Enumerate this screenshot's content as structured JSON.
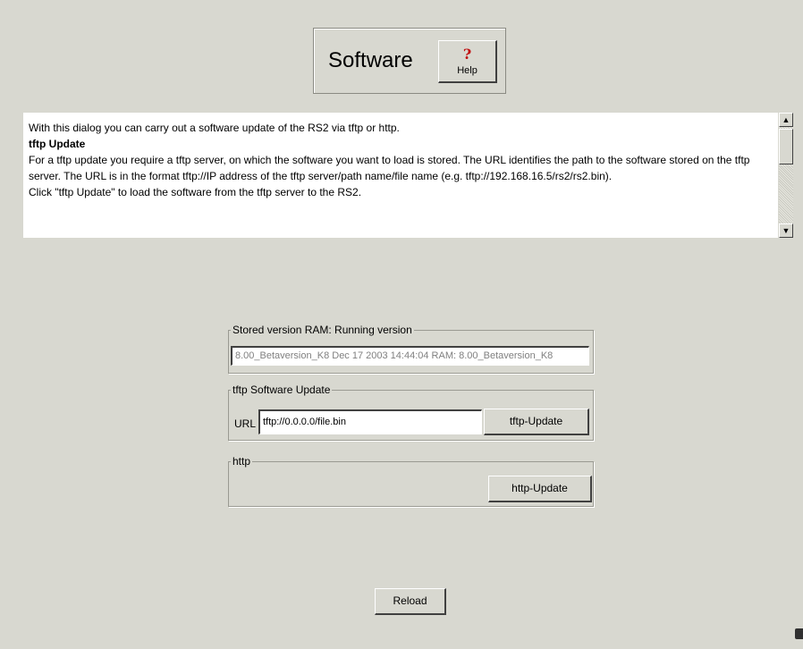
{
  "header": {
    "title": "Software",
    "help_icon": "help-question-icon",
    "help_label": "Help"
  },
  "info": {
    "intro": "With this dialog you can carry out a software update of the RS2 via tftp or http.",
    "tftp_heading": "tftp Update",
    "tftp_desc": "For a tftp update you require a tftp server, on which the software you want to load is stored. The URL identifies the path to the software stored on the tftp server. The URL is in the format tftp://IP address of the tftp server/path name/file name (e.g. tftp://192.168.16.5/rs2/rs2.bin).",
    "tftp_click": "Click \"tftp Update\" to load the software from the tftp server to the RS2."
  },
  "stored_version": {
    "legend": "Stored version  RAM:  Running version",
    "value": "8.00_Betaversion_K8 Dec 17 2003 14:44:04 RAM: 8.00_Betaversion_K8"
  },
  "tftp_update": {
    "legend": "tftp Software Update",
    "url_label": "URL",
    "url_value": "tftp://0.0.0.0/file.bin",
    "button_label": "tftp-Update"
  },
  "http": {
    "legend": "http",
    "button_label": "http-Update"
  },
  "reload_label": "Reload",
  "colors": {
    "background": "#d8d8d0",
    "help_icon": "#c01010"
  }
}
